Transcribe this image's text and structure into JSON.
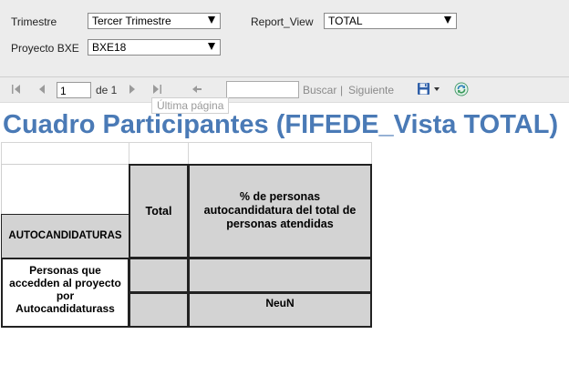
{
  "params": {
    "trimestre_label": "Trimestre",
    "trimestre_value": "Tercer Trimestre",
    "report_view_label": "Report_View",
    "report_view_value": "TOTAL",
    "proyecto_label": "Proyecto BXE",
    "proyecto_value": "BXE18"
  },
  "toolbar": {
    "page_value": "1",
    "of_pages": "de 1",
    "find_label": "Buscar",
    "separator": "|",
    "next_label": "Siguiente",
    "tooltip": "Última página",
    "icons": [
      "first-page-icon",
      "prev-page-icon",
      "next-page-icon",
      "last-page-icon",
      "back-icon",
      "save-icon",
      "dropdown-icon",
      "refresh-icon"
    ]
  },
  "report": {
    "title": "Cuadro Participantes (FIFEDE_Vista TOTAL)",
    "section_header": "AUTOCANDIDATURAS",
    "col_total": "Total",
    "col_percent": "% de personas autocandidatura del total de personas atendidas",
    "row_label": "Personas que accedden al proyecto por Autocandidaturass",
    "row_percent_value": "NeuN"
  },
  "colors": {
    "title": "#4a7ab6",
    "header_fill": "#d3d3d3",
    "toolbar_bg": "#ececec"
  }
}
